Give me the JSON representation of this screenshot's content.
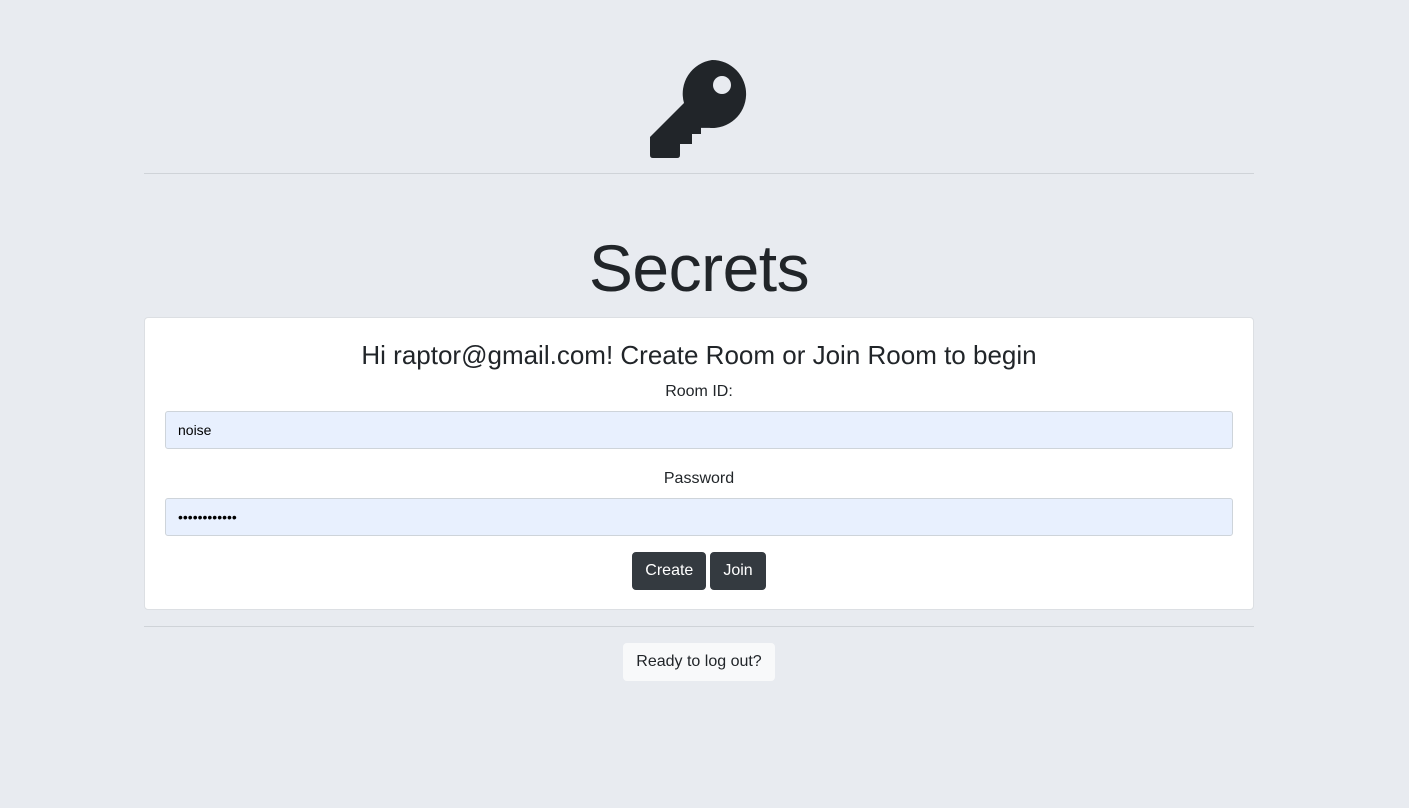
{
  "logo": {
    "icon": "key-icon",
    "color": "#212529"
  },
  "page": {
    "title": "Secrets"
  },
  "card": {
    "greeting": "Hi raptor@gmail.com! Create Room or Join Room to begin",
    "room_id_label": "Room ID:",
    "room_id_value": "noise",
    "password_label": "Password",
    "password_value": "••••••••••••",
    "create_label": "Create",
    "join_label": "Join"
  },
  "footer": {
    "logout_label": "Ready to log out?"
  },
  "colors": {
    "background": "#e8ebf0",
    "button_dark": "#343a40",
    "input_autofill": "#e8f0fe"
  }
}
